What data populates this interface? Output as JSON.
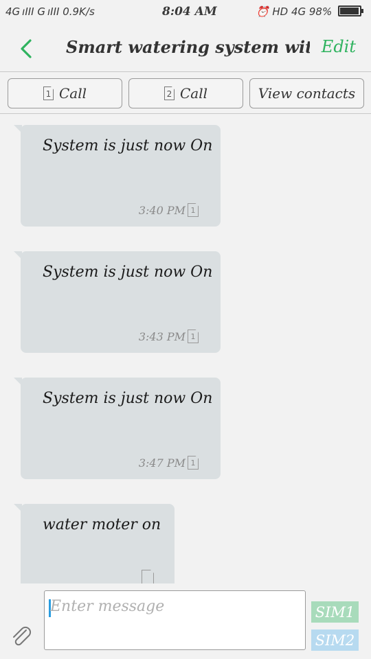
{
  "status_bar": {
    "left": "4G ıIII  G ıIII  0.9K/s",
    "time": "8:04 AM",
    "right": "HD 4G 98%"
  },
  "header": {
    "title": "Smart watering system with G...",
    "edit_label": "Edit"
  },
  "actions": {
    "call1_label": "Call",
    "call1_sim": "1",
    "call2_label": "Call",
    "call2_sim": "2",
    "view_contacts_label": "View contacts"
  },
  "messages": [
    {
      "text": "System is just now On",
      "time": "3:40 PM",
      "sim": "1"
    },
    {
      "text": "System is just now On",
      "time": "3:43 PM",
      "sim": "1"
    },
    {
      "text": "System is just now On",
      "time": "3:47 PM",
      "sim": "1"
    },
    {
      "text": "water moter on",
      "time": "",
      "sim": ""
    }
  ],
  "composer": {
    "placeholder": "Enter message",
    "sim1_label": "SIM1",
    "sim2_label": "SIM2"
  },
  "colors": {
    "accent_green": "#2fb35f",
    "bubble": "#dadfe1",
    "sim1": "#a8dbbb",
    "sim2": "#b7daf0"
  }
}
